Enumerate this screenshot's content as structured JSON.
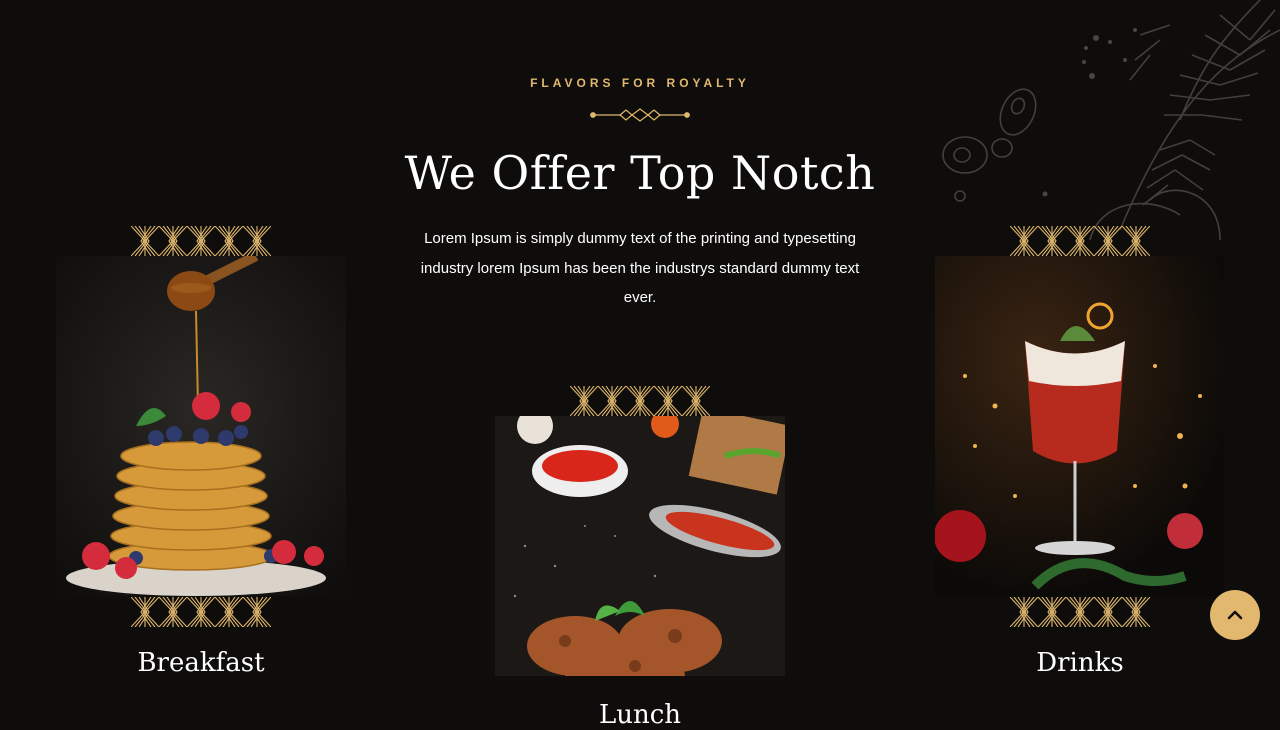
{
  "section": {
    "kicker": "FLAVORS FOR ROYALTY",
    "title": "We Offer Top Notch",
    "description": "Lorem Ipsum is simply dummy text of the printing and typesetting industry lorem Ipsum has been the industrys standard dummy text ever."
  },
  "cards": [
    {
      "image": "pancake stack with honey, blueberries and raspberries",
      "title": "Breakfast"
    },
    {
      "image": "grilled chicken with herbs and dipping sauces",
      "title": "Lunch"
    },
    {
      "image": "red cocktail in a glass with festive lights",
      "title": "Drinks"
    }
  ],
  "colors": {
    "background": "#0f0d0c",
    "accent": "#e1b86e",
    "text": "#ffffff"
  },
  "icons": {
    "scroll_top": "chevron-up-icon",
    "divider": "ornament-divider-icon"
  }
}
